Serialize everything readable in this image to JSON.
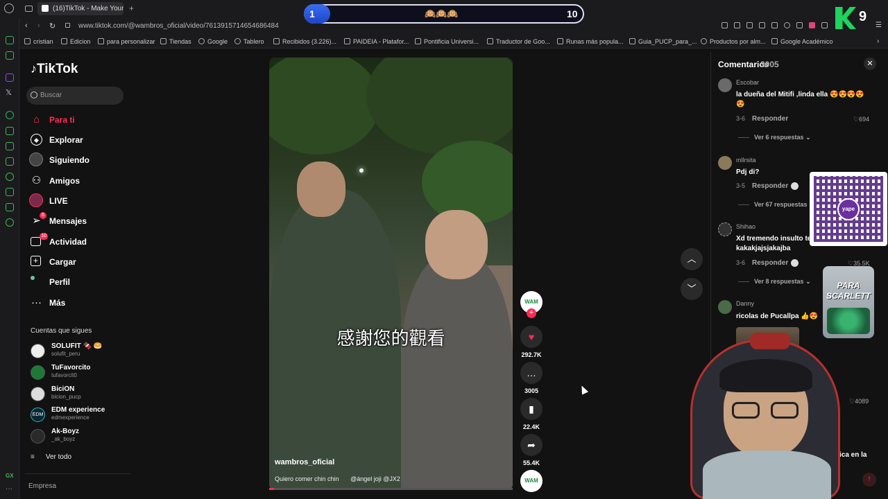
{
  "browser": {
    "tab_title": "(16)TikTok - Make Your",
    "url": "www.tiktok.com/@wambros_oficial/video/7613915714654686484",
    "bookmarks": [
      "cristian",
      "Edicion",
      "para personalizar",
      "Tiendas",
      "Google",
      "Tablero",
      "Recibidos (3.226)...",
      "PAIDEIA - Platafor...",
      "Pontificia Universi...",
      "Traductor de Goo...",
      "Runas más popula...",
      "Guia_PUCP_para_...",
      "Productos por alm...",
      "Google Académico"
    ]
  },
  "overlay": {
    "left_score": "1",
    "right_score": "10",
    "emojis": "🙉🙉🙉",
    "k_counter": "9",
    "jar_text": "PARA SCARLETT",
    "qr_label": "yape"
  },
  "sidebar": {
    "logo": "TikTok",
    "search_placeholder": "Buscar",
    "nav": [
      {
        "label": "Para ti",
        "icon": "home-icon"
      },
      {
        "label": "Explorar",
        "icon": "compass-icon"
      },
      {
        "label": "Siguiendo",
        "icon": "following-icon"
      },
      {
        "label": "Amigos",
        "icon": "friends-icon"
      },
      {
        "label": "LIVE",
        "icon": "live-icon"
      },
      {
        "label": "Mensajes",
        "icon": "messages-icon",
        "badge": "6"
      },
      {
        "label": "Actividad",
        "icon": "activity-icon",
        "badge": "10"
      },
      {
        "label": "Cargar",
        "icon": "upload-icon"
      },
      {
        "label": "Perfil",
        "icon": "profile-icon"
      },
      {
        "label": "Más",
        "icon": "more-icon"
      }
    ],
    "following_title": "Cuentas que sigues",
    "accounts": [
      {
        "name": "SOLUFIT 🍫 🥯",
        "handle": "solufit_peru"
      },
      {
        "name": "TuFavorcito",
        "handle": "tufavorcit0"
      },
      {
        "name": "BiciON",
        "handle": "bicion_pucp"
      },
      {
        "name": "EDM experience",
        "handle": "edmexperience",
        "avatar_text": "EDM"
      },
      {
        "name": "Ak-Boyz",
        "handle": "_ak_boyz"
      }
    ],
    "see_all": "Ver todo",
    "footer": "Empresa"
  },
  "video": {
    "subtitle": "感謝您的觀看",
    "author": "wambros_oficial",
    "caption": "Quiero comer chin chin",
    "caption_tags": "@ángel joji @JX2",
    "progress": 0.02
  },
  "actions": {
    "likes": "292.7K",
    "comments": "3005",
    "saves": "22.4K",
    "shares": "55.4K"
  },
  "comments": {
    "title": "Comentarios",
    "count": "3005",
    "reply_label": "Responder",
    "items": [
      {
        "user": "Escobar",
        "text": "la dueña del Mitifi ,linda ella 😍😍😍😍😍",
        "date": "3-6",
        "likes": "694",
        "more": "Ver 6 respuestas"
      },
      {
        "user": "mllrsita",
        "text": "Pdj di?",
        "date": "3-5",
        "likes": "",
        "more": "Ver 67 respuestas"
      },
      {
        "user": "Shihao",
        "text": "Xd tremendo insulto te kakakjajsjakajba",
        "date": "3-6",
        "likes": "35.5K",
        "more": "Ver 8 respuestas"
      },
      {
        "user": "Danny",
        "text": "ricolas de Pucallpa 👍😍",
        "date": "",
        "likes": "4089",
        "more": ""
      }
    ],
    "partial_text": "ica en la"
  },
  "colors": {
    "accent": "#fe2c55",
    "background": "#121212",
    "rail_accent": "#3fb950"
  }
}
